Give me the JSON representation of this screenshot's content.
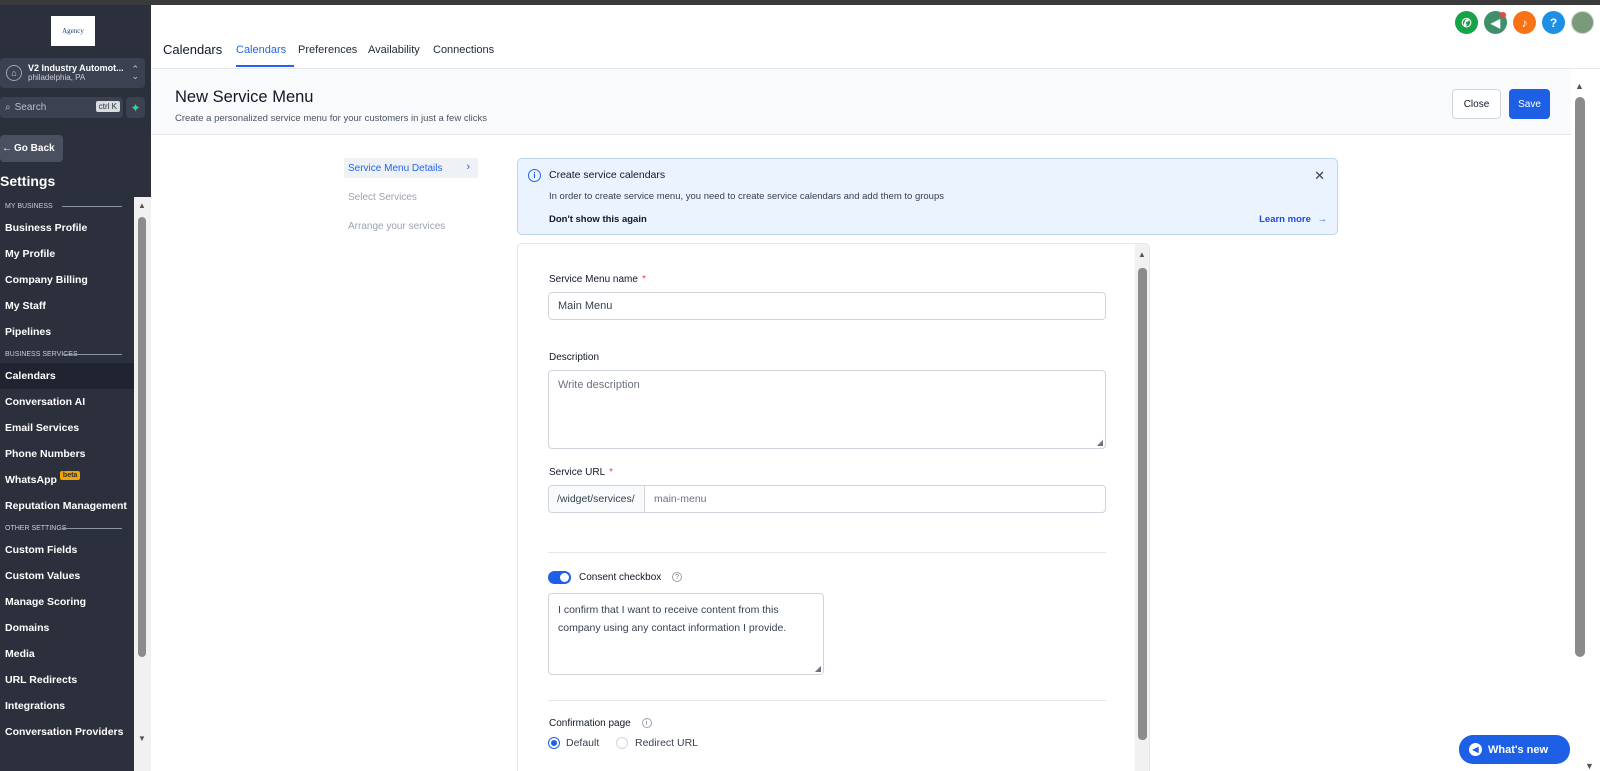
{
  "sidebar": {
    "logo_text": "Agency",
    "account": {
      "name": "V2 Industry Automot...",
      "location": "philadelphia, PA"
    },
    "search": {
      "placeholder": "Search",
      "shortcut": "ctrl K"
    },
    "go_back": "Go Back",
    "title": "Settings",
    "sections": [
      {
        "label": "MY BUSINESS",
        "items": [
          "Business Profile",
          "My Profile",
          "Company Billing",
          "My Staff",
          "Pipelines"
        ]
      },
      {
        "label": "BUSINESS SERVICES",
        "items": [
          "Calendars",
          "Conversation AI",
          "Email Services",
          "Phone Numbers",
          "WhatsApp",
          "Reputation Management"
        ]
      },
      {
        "label": "OTHER SETTINGS",
        "items": [
          "Custom Fields",
          "Custom Values",
          "Manage Scoring",
          "Domains",
          "Media",
          "URL Redirects",
          "Integrations",
          "Conversation Providers"
        ]
      }
    ],
    "active_item": "Calendars",
    "whatsapp_badge": "beta"
  },
  "topbar": {
    "app_title": "Calendars",
    "tabs": [
      "Calendars",
      "Preferences",
      "Availability",
      "Connections"
    ],
    "active_tab": "Calendars",
    "icons": [
      {
        "name": "phone-icon",
        "glyph": "✆",
        "color": "#16a34a"
      },
      {
        "name": "megaphone-icon",
        "glyph": "📢",
        "color": "#3f8f6a"
      },
      {
        "name": "bell-icon",
        "glyph": "🔔",
        "color": "#f97316"
      },
      {
        "name": "help-icon",
        "glyph": "?",
        "color": "#1d8fe5"
      },
      {
        "name": "avatar",
        "glyph": "",
        "color": "#6b8e6b"
      }
    ]
  },
  "header": {
    "title": "New Service Menu",
    "subtitle": "Create a personalized service menu for your customers in just a few clicks",
    "close_label": "Close",
    "save_label": "Save"
  },
  "steps": [
    "Service Menu Details",
    "Select Services",
    "Arrange your services"
  ],
  "banner": {
    "title": "Create service calendars",
    "text": "In order to create service menu, you need to create service calendars and add them to groups",
    "dismiss": "Don't show this again",
    "learn_more": "Learn more"
  },
  "form": {
    "name_label": "Service Menu name",
    "name_value": "Main Menu",
    "description_label": "Description",
    "description_placeholder": "Write description",
    "url_label": "Service URL",
    "url_prefix": "/widget/services/",
    "url_value": "main-menu",
    "consent_label": "Consent checkbox",
    "consent_enabled": true,
    "consent_text": "I confirm that I want to receive content from this company using any contact information I provide.",
    "confirmation_label": "Confirmation page",
    "confirmation_options": [
      "Default",
      "Redirect URL"
    ],
    "confirmation_selected": "Default"
  },
  "whats_new": "What's new"
}
